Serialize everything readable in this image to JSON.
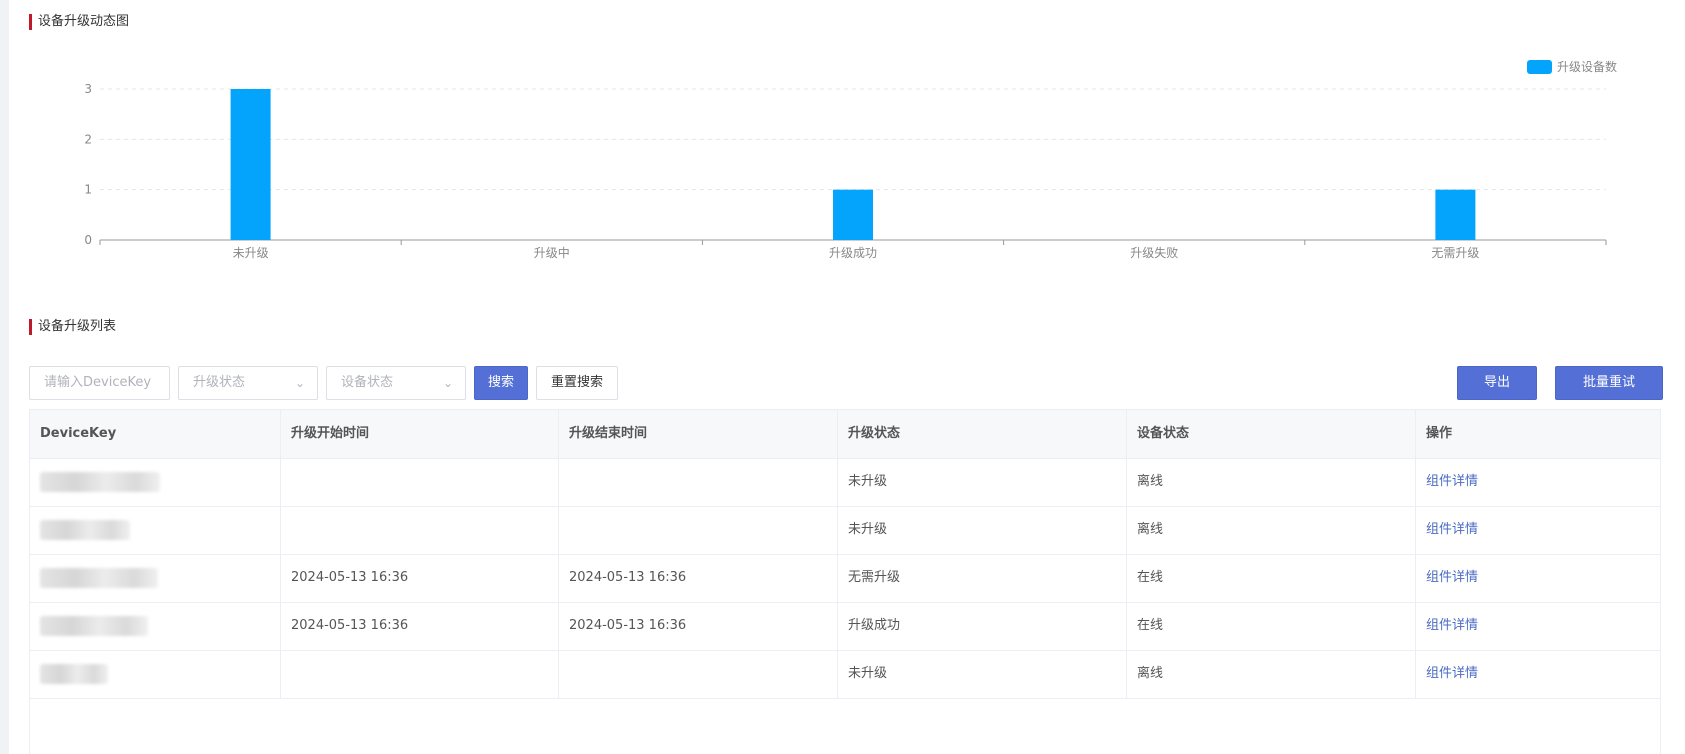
{
  "sections": {
    "chart_title": "设备升级动态图",
    "list_title": "设备升级列表"
  },
  "chart_data": {
    "type": "bar",
    "categories": [
      "未升级",
      "升级中",
      "升级成功",
      "升级失败",
      "无需升级"
    ],
    "series": [
      {
        "name": "升级设备数",
        "values": [
          3,
          0,
          1,
          0,
          1
        ],
        "color": "#05a4fc"
      }
    ],
    "yticks": [
      0,
      1,
      2,
      3
    ],
    "ylim": [
      0,
      3
    ],
    "grid": true,
    "legend": "top-right"
  },
  "toolbar": {
    "devicekey_placeholder": "请输入DeviceKey",
    "upgrade_status_placeholder": "升级状态",
    "device_status_placeholder": "设备状态",
    "search_label": "搜索",
    "reset_label": "重置搜索",
    "export_label": "导出",
    "batch_retry_label": "批量重试"
  },
  "table": {
    "headers": [
      "DeviceKey",
      "升级开始时间",
      "升级结束时间",
      "升级状态",
      "设备状态",
      "操作"
    ],
    "rows": [
      {
        "start": "",
        "end": "",
        "upgrade_status": "未升级",
        "device_status": "离线",
        "action": "组件详情"
      },
      {
        "start": "",
        "end": "",
        "upgrade_status": "未升级",
        "device_status": "离线",
        "action": "组件详情"
      },
      {
        "start": "2024-05-13 16:36",
        "end": "2024-05-13 16:36",
        "upgrade_status": "无需升级",
        "device_status": "在线",
        "action": "组件详情"
      },
      {
        "start": "2024-05-13 16:36",
        "end": "2024-05-13 16:36",
        "upgrade_status": "升级成功",
        "device_status": "在线",
        "action": "组件详情"
      },
      {
        "start": "",
        "end": "",
        "upgrade_status": "未升级",
        "device_status": "离线",
        "action": "组件详情"
      }
    ]
  },
  "colors": {
    "accent": "#5470d6",
    "bar": "#05a4fc",
    "title_marker": "#c0192b",
    "link": "#4a6cc4"
  }
}
